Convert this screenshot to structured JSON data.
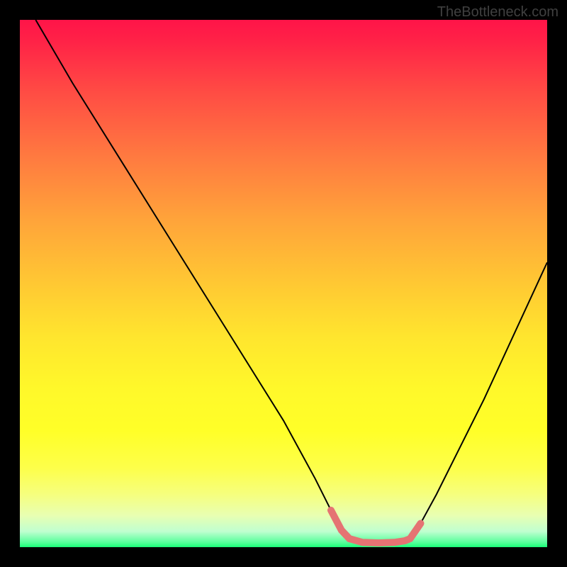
{
  "watermark": "TheBottleneck.com",
  "highlight_color": "#e57373",
  "highlight_width": 10,
  "chart_data": {
    "type": "line",
    "title": "",
    "xlabel": "",
    "ylabel": "",
    "xlim": [
      0,
      100
    ],
    "ylim": [
      0,
      100
    ],
    "series": [
      {
        "name": "left-curve",
        "x": [
          3,
          10,
          20,
          30,
          40,
          50,
          56,
          59,
          61,
          62.5
        ],
        "y": [
          100,
          88,
          72,
          56,
          40,
          24,
          13,
          7,
          3.2,
          1.6
        ]
      },
      {
        "name": "right-curve",
        "x": [
          74,
          76,
          79,
          83,
          88,
          94,
          100
        ],
        "y": [
          1.6,
          4.5,
          10,
          18,
          28,
          41,
          54
        ]
      },
      {
        "name": "bottom-highlight",
        "x": [
          59,
          61,
          62.5,
          65,
          68,
          71,
          73,
          74,
          76
        ],
        "y": [
          7,
          3.2,
          1.6,
          0.9,
          0.8,
          0.9,
          1.2,
          1.6,
          4.5
        ]
      }
    ]
  }
}
